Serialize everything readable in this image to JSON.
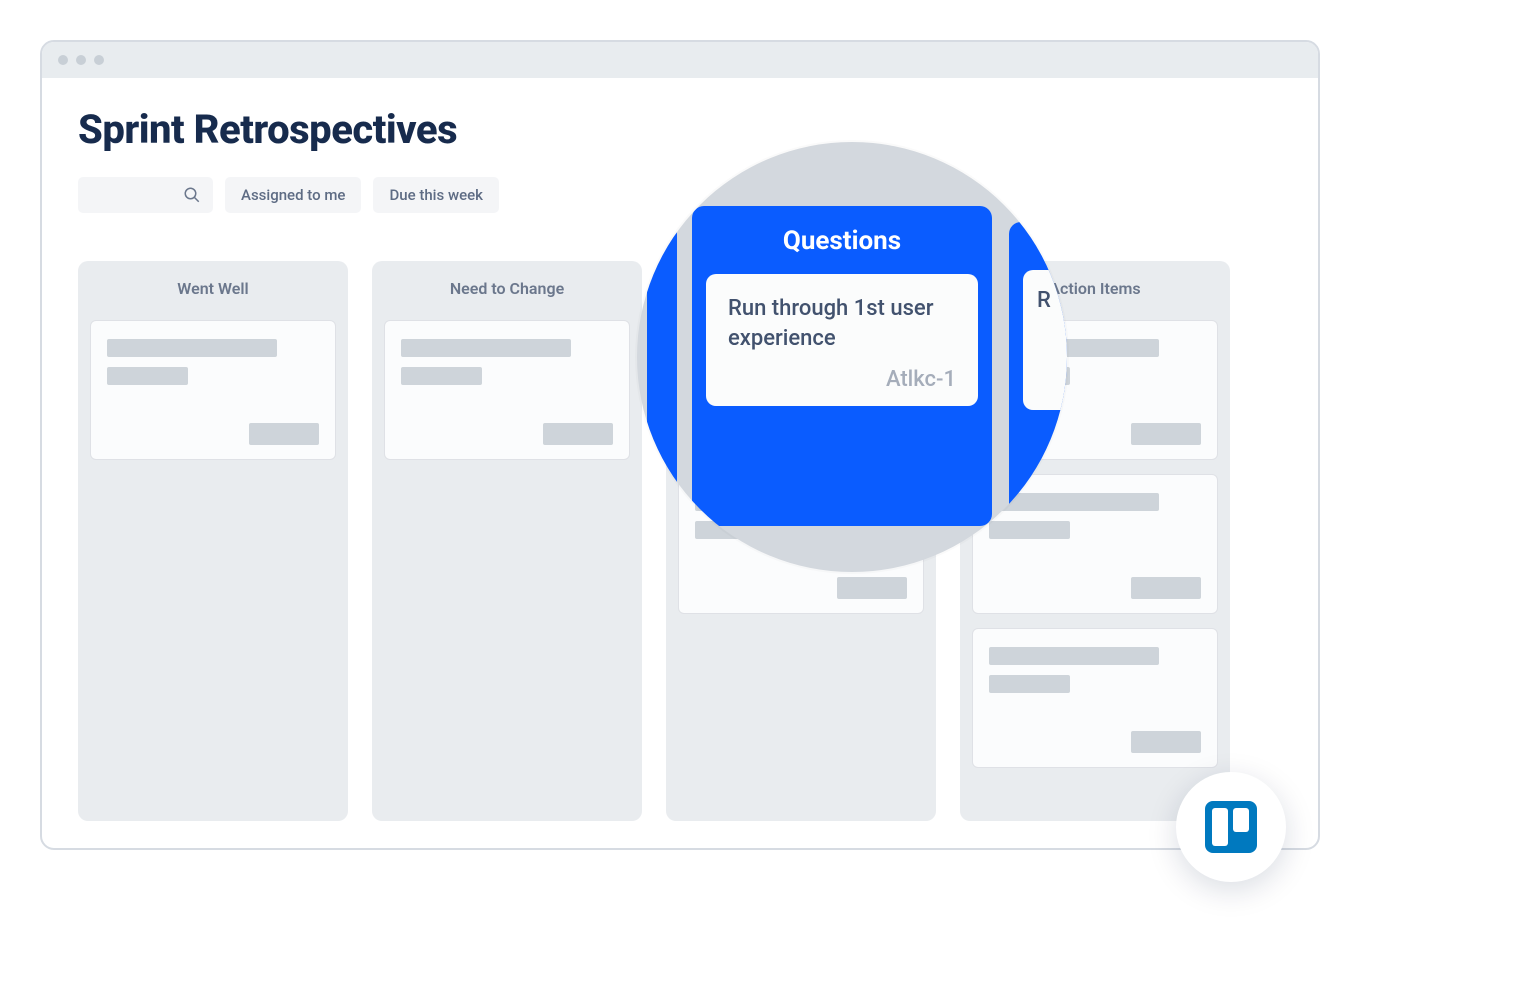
{
  "page": {
    "title": "Sprint Retrospectives"
  },
  "filters": {
    "assigned": "Assigned to me",
    "due": "Due this week"
  },
  "columns": [
    {
      "title": "Went Well"
    },
    {
      "title": "Need to Change"
    },
    {
      "title": "Questions"
    },
    {
      "title": "Action Items"
    }
  ],
  "magnifier": {
    "column_title": "Questions",
    "card_text": "Run through 1st user experience",
    "card_id": "Atlkc-1",
    "right_peek": "R"
  }
}
